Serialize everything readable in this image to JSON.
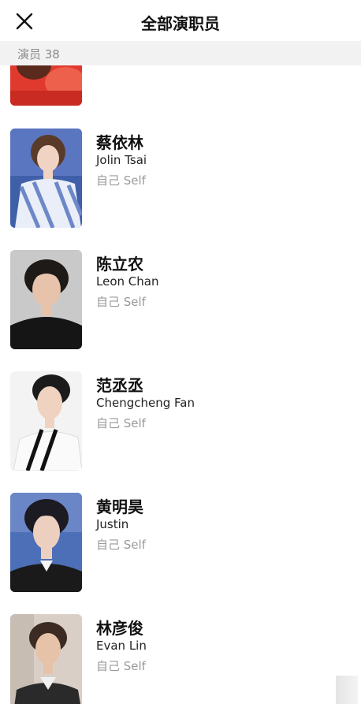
{
  "header": {
    "title": "全部演职员",
    "close_icon": "close-icon"
  },
  "count_bar": {
    "label": "演员 38"
  },
  "cast": [
    {
      "name_cn": "蔡依林",
      "name_en": "Jolin Tsai",
      "role": "自己 Self",
      "photo_colors": {
        "bg": "#3f5fa8",
        "hair": "#5a3b2a",
        "skin": "#f0d3c2",
        "shirt": "#8fa7d8"
      }
    },
    {
      "name_cn": "陈立农",
      "name_en": "Leon Chan",
      "role": "自己 Self",
      "photo_colors": {
        "bg": "#c9c9c9",
        "hair": "#1d1a18",
        "skin": "#e7c3ab",
        "shirt": "#151515"
      }
    },
    {
      "name_cn": "范丞丞",
      "name_en": "Chengcheng Fan",
      "role": "自己 Self",
      "photo_colors": {
        "bg": "#f3f3f3",
        "hair": "#1b1b1b",
        "skin": "#efd2bf",
        "shirt": "#fafafa"
      }
    },
    {
      "name_cn": "黄明昊",
      "name_en": "Justin",
      "role": "自己 Self",
      "photo_colors": {
        "bg": "#4d6fb8",
        "hair": "#1c1a22",
        "skin": "#edcfc0",
        "shirt": "#1a1a1a"
      }
    },
    {
      "name_cn": "林彦俊",
      "name_en": "Evan Lin",
      "role": "自己 Self",
      "photo_colors": {
        "bg": "#d9cfc7",
        "hair": "#3b2b22",
        "skin": "#e6c3a8",
        "shirt": "#2a2a2a"
      }
    }
  ],
  "partial_top_row": {
    "photo_color": "#e03a2e"
  }
}
